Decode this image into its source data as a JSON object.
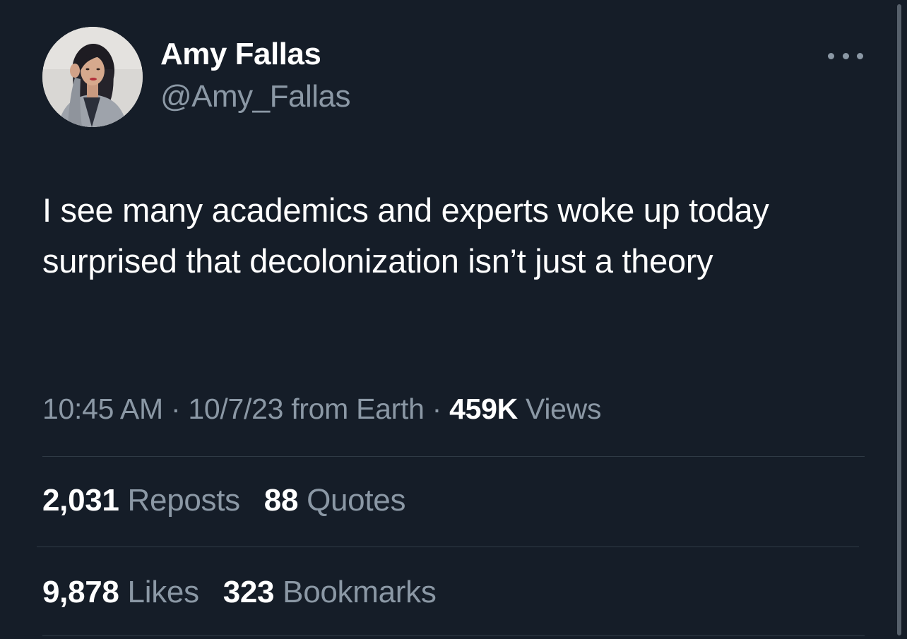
{
  "author": {
    "display_name": "Amy Fallas",
    "handle": "@Amy_Fallas"
  },
  "tweet": {
    "text": "I see many academics and experts woke up today surprised that decolonization isn’t just a theory"
  },
  "meta": {
    "time": "10:45 AM",
    "separator": "·",
    "date": "10/7/23",
    "source": "from Earth",
    "views_count": "459K",
    "views_label": "Views"
  },
  "stats": {
    "reposts_count": "2,031",
    "reposts_label": "Reposts",
    "quotes_count": "88",
    "quotes_label": "Quotes",
    "likes_count": "9,878",
    "likes_label": "Likes",
    "bookmarks_count": "323",
    "bookmarks_label": "Bookmarks"
  },
  "icons": {
    "more": "more-horizontal-icon",
    "avatar": "profile-photo"
  },
  "colors": {
    "background": "#151d28",
    "primary_text": "#ffffff",
    "secondary_text": "#8b98a5",
    "divider": "#2f3a45"
  }
}
